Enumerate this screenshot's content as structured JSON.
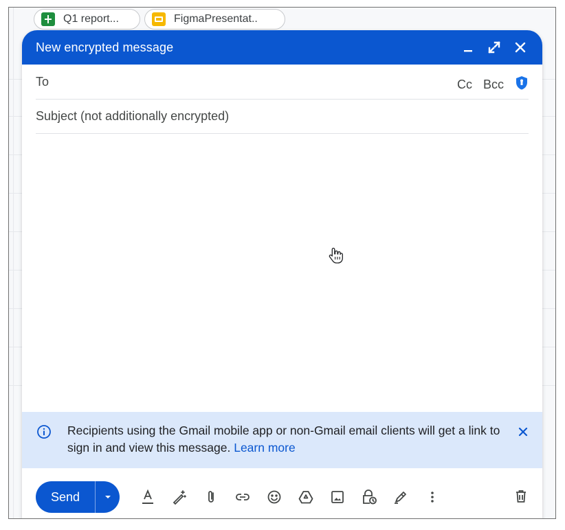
{
  "tabs": [
    {
      "label": "Q1 report...",
      "icon": "sheets-icon",
      "color": "#1e8e3e"
    },
    {
      "label": "FigmaPresentat..",
      "icon": "slides-icon",
      "color": "#f6b800"
    }
  ],
  "compose": {
    "title": "New encrypted message",
    "header_color": "#0b57d0",
    "window_controls": [
      "minimize-icon",
      "expand-icon",
      "close-icon"
    ],
    "to_label": "To",
    "cc_label": "Cc",
    "bcc_label": "Bcc",
    "subject_label": "Subject (not additionally encrypted)"
  },
  "banner": {
    "text": "Recipients using the Gmail mobile app or non-Gmail email clients will get a link to sign in and view this message.",
    "link_label": "Learn more",
    "background": "#dbe8fb"
  },
  "toolbar": {
    "send_label": "Send",
    "tools": [
      "formatting-icon",
      "ai-help-me-write-icon",
      "attach-icon",
      "link-icon",
      "emoji-icon",
      "drive-icon",
      "photo-icon",
      "confidential-mode-icon",
      "signature-icon",
      "more-options-icon"
    ],
    "discard": "trash-icon"
  }
}
